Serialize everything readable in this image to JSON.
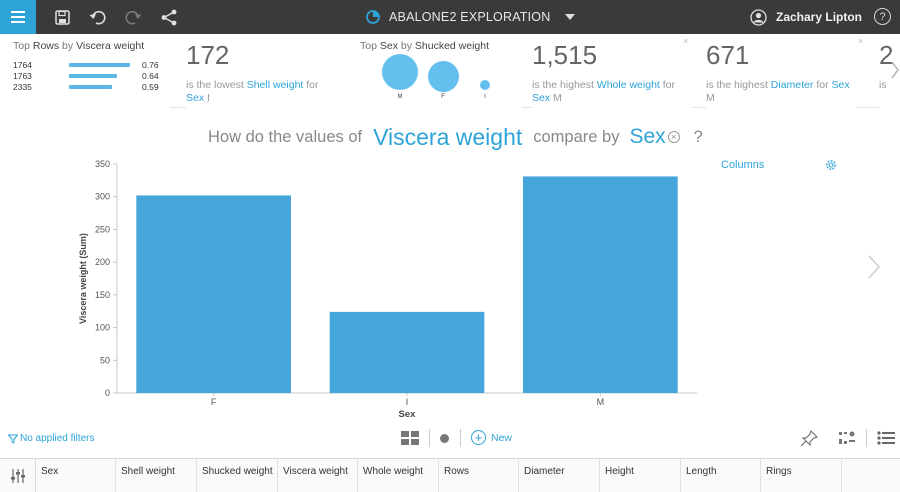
{
  "app": {
    "title": "ABALONE2 EXPLORATION",
    "user": "Zachary Lipton",
    "help_label": "?",
    "accent": "#2ea3d8"
  },
  "toolbar": {
    "icons": [
      "menu-icon",
      "save-icon",
      "undo-icon",
      "redo-icon",
      "share-icon"
    ]
  },
  "insights": {
    "top_rows": {
      "prefix": "Top",
      "field1": "Rows",
      "mid": "by",
      "field2": "Viscera weight",
      "rows": [
        {
          "label": "1764",
          "value": "0.76",
          "ratio": 1.0
        },
        {
          "label": "1763",
          "value": "0.64",
          "ratio": 0.84
        },
        {
          "label": "2335",
          "value": "0.59",
          "ratio": 0.78
        }
      ]
    },
    "lowest_shell": {
      "number": "172",
      "text": "is the lowest",
      "field": "Shell weight",
      "for": "for",
      "dim": "Sex",
      "dim_value": "I"
    },
    "top_sex": {
      "prefix": "Top",
      "field1": "Sex",
      "mid": "by",
      "field2": "Shucked weight",
      "bubbles": [
        {
          "label": "M",
          "ratio": 1.0
        },
        {
          "label": "F",
          "ratio": 0.86
        },
        {
          "label": "I",
          "ratio": 0.28
        }
      ]
    },
    "highest_whole": {
      "number": "1,515",
      "text": "is the highest",
      "field": "Whole weight",
      "for": "for",
      "dim": "Sex",
      "dim_value": "M"
    },
    "highest_diameter": {
      "number": "671",
      "text": "is the highest",
      "field": "Diameter",
      "for": "for",
      "dim": "Sex",
      "dim_value": "M"
    },
    "partial": {
      "number": "2",
      "text": "is"
    }
  },
  "question": {
    "before": "How do the values of",
    "measure": "Viscera weight",
    "middle": "compare by",
    "dimension": "Sex",
    "end": "?"
  },
  "chart_panel": {
    "type_label": "Columns"
  },
  "chart_data": {
    "type": "bar",
    "categories": [
      "F",
      "I",
      "M"
    ],
    "values": [
      302,
      124,
      331
    ],
    "xlabel": "Sex",
    "ylabel": "Viscera weight (Sum)",
    "ylim": [
      0,
      350
    ],
    "yticks": [
      0,
      50,
      100,
      150,
      200,
      250,
      300,
      350
    ],
    "grid": false,
    "bar_color": "#44a6da"
  },
  "bottom_bar": {
    "filters_label": "No applied filters",
    "new_label": "New"
  },
  "grid": {
    "columns": [
      "Sex",
      "Shell weight",
      "Shucked weight",
      "Viscera weight",
      "Whole weight",
      "Rows",
      "Diameter",
      "Height",
      "Length",
      "Rings"
    ]
  }
}
